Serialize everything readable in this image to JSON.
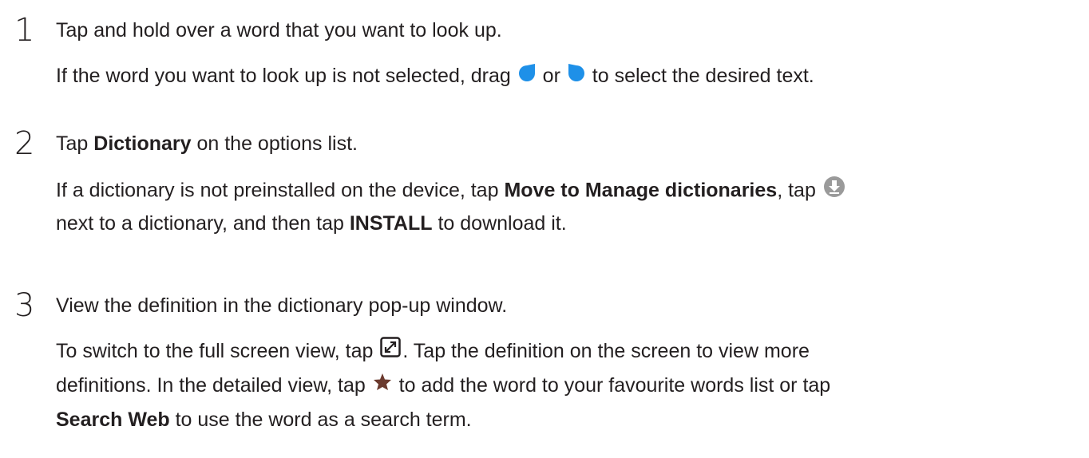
{
  "steps": [
    {
      "number": "1",
      "lines": [
        {
          "segments": [
            {
              "t": "Tap and hold over a word that you want to look up."
            }
          ]
        },
        {
          "segments": [
            {
              "t": "If the word you want to look up is not selected, drag "
            },
            {
              "icon": "left-selection-handle-icon"
            },
            {
              "t": " or "
            },
            {
              "icon": "right-selection-handle-icon"
            },
            {
              "t": " to select the desired text."
            }
          ]
        }
      ]
    },
    {
      "number": "2",
      "lines": [
        {
          "segments": [
            {
              "t": "Tap "
            },
            {
              "t": "Dictionary",
              "bold": true
            },
            {
              "t": " on the options list."
            }
          ]
        },
        {
          "segments": [
            {
              "t": "If a dictionary is not preinstalled on the device, tap "
            },
            {
              "t": "Move to Manage dictionaries",
              "bold": true
            },
            {
              "t": ", tap "
            },
            {
              "icon": "download-icon"
            }
          ]
        },
        {
          "segments": [
            {
              "t": "next to a dictionary, and then tap "
            },
            {
              "t": "INSTALL",
              "bold": true
            },
            {
              "t": " to download it."
            }
          ]
        }
      ]
    },
    {
      "number": "3",
      "lines": [
        {
          "segments": [
            {
              "t": "View the definition in the dictionary pop-up window."
            }
          ]
        },
        {
          "segments": [
            {
              "t": "To switch to the full screen view, tap "
            },
            {
              "icon": "expand-icon"
            },
            {
              "t": ". Tap the definition on the screen to view more"
            }
          ]
        },
        {
          "segments": [
            {
              "t": "definitions. In the detailed view, tap "
            },
            {
              "icon": "star-icon"
            },
            {
              "t": " to add the word to your favourite words list or tap"
            }
          ]
        },
        {
          "segments": [
            {
              "t": "Search Web",
              "bold": true
            },
            {
              "t": " to use the word as a search term."
            }
          ]
        }
      ]
    }
  ],
  "colors": {
    "text": "#231f20",
    "handle_blue": "#1e90e8",
    "download_grey": "#9a9a9a",
    "star_brown": "#6b3a2e"
  }
}
